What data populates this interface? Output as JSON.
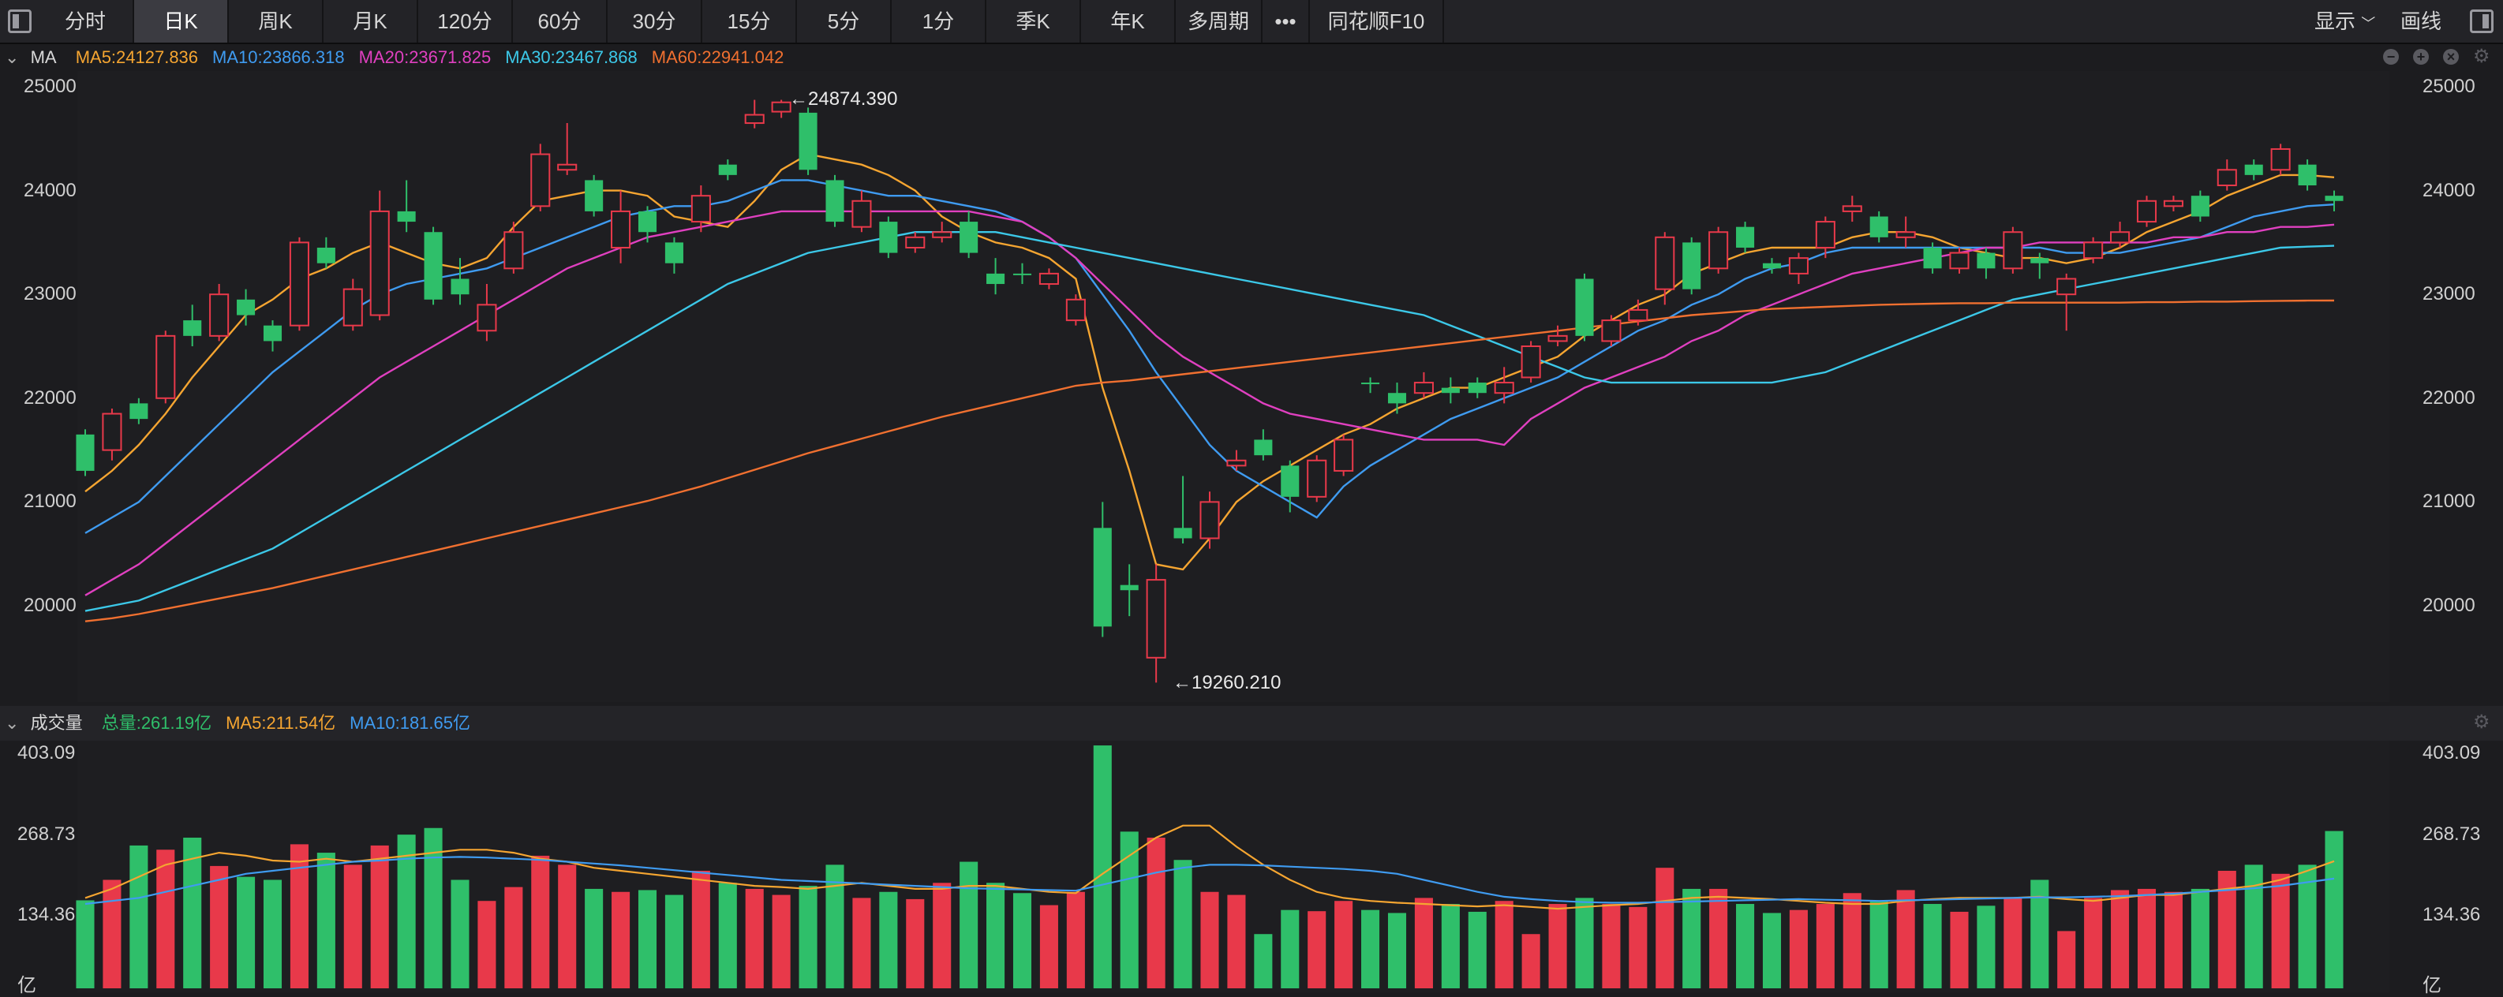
{
  "toolbar": {
    "tabs": [
      "分时",
      "日K",
      "周K",
      "月K",
      "120分",
      "60分",
      "30分",
      "15分",
      "5分",
      "1分",
      "季K",
      "年K",
      "多周期"
    ],
    "more": "•••",
    "f10": "同花顺F10",
    "display": "显示",
    "draw": "画线",
    "active_tab": "日K"
  },
  "ma_legend": {
    "label": "MA",
    "items": [
      {
        "text": "MA5:24127.836",
        "color": "#f5a531"
      },
      {
        "text": "MA10:23866.318",
        "color": "#3f9bf0"
      },
      {
        "text": "MA20:23671.825",
        "color": "#e040c0"
      },
      {
        "text": "MA30:23467.868",
        "color": "#3cc8e8"
      },
      {
        "text": "MA60:22941.042",
        "color": "#f07030"
      }
    ]
  },
  "price_axis": [
    "25000",
    "24000",
    "23000",
    "22000",
    "21000",
    "20000"
  ],
  "annotations": {
    "high": "←24874.390",
    "low": "←19260.210"
  },
  "volume_legend": {
    "label": "成交量",
    "items": [
      {
        "text": "总量:261.19亿",
        "color": "#2fbf6a"
      },
      {
        "text": "MA5:211.54亿",
        "color": "#f5a531"
      },
      {
        "text": "MA10:181.65亿",
        "color": "#3f9bf0"
      }
    ]
  },
  "volume_axis": [
    "403.09",
    "268.73",
    "134.36",
    "亿"
  ],
  "colors": {
    "up": "#e8394a",
    "down": "#2fbf6a"
  },
  "chart_data": {
    "type": "candlestick",
    "ylim": [
      19000,
      25200
    ],
    "volume_ylim": [
      0,
      403.09
    ],
    "candles": [
      [
        21650,
        21300,
        21700,
        21250,
        "d",
        146
      ],
      [
        21500,
        21850,
        21900,
        21400,
        "u",
        180
      ],
      [
        21800,
        21950,
        22000,
        21750,
        "d",
        237
      ],
      [
        22000,
        22600,
        22650,
        21950,
        "u",
        230
      ],
      [
        22750,
        22600,
        22900,
        22500,
        "d",
        250
      ],
      [
        22600,
        23000,
        23100,
        22550,
        "u",
        203
      ],
      [
        22950,
        22800,
        23050,
        22700,
        "d",
        185
      ],
      [
        22700,
        22550,
        22750,
        22450,
        "d",
        180
      ],
      [
        22700,
        23500,
        23550,
        22650,
        "u",
        239
      ],
      [
        23450,
        23300,
        23550,
        23250,
        "d",
        225
      ],
      [
        22700,
        23050,
        23150,
        22650,
        "u",
        205
      ],
      [
        22800,
        23800,
        24000,
        22750,
        "u",
        237
      ],
      [
        23800,
        23700,
        24100,
        23600,
        "d",
        255
      ],
      [
        23600,
        22950,
        23650,
        22900,
        "d",
        266
      ],
      [
        23150,
        23000,
        23350,
        22900,
        "d",
        180
      ],
      [
        22650,
        22900,
        23100,
        22550,
        "u",
        145
      ],
      [
        23250,
        23600,
        23700,
        23200,
        "u",
        168
      ],
      [
        23850,
        24350,
        24450,
        23800,
        "u",
        220
      ],
      [
        24200,
        24250,
        24650,
        24150,
        "u",
        205
      ],
      [
        24100,
        23800,
        24150,
        23750,
        "d",
        165
      ],
      [
        23800,
        23450,
        24000,
        23300,
        "u",
        160
      ],
      [
        23800,
        23600,
        23850,
        23500,
        "d",
        163
      ],
      [
        23500,
        23300,
        23550,
        23200,
        "d",
        155
      ],
      [
        23700,
        23950,
        24050,
        23600,
        "u",
        195
      ],
      [
        24150,
        24250,
        24300,
        24100,
        "d",
        175
      ],
      [
        24650,
        24730,
        24874,
        24600,
        "u",
        165
      ],
      [
        24760,
        24850,
        24874,
        24700,
        "u",
        155
      ],
      [
        24750,
        24200,
        24800,
        24150,
        "d",
        170
      ],
      [
        24100,
        23700,
        24150,
        23650,
        "d",
        205
      ],
      [
        23650,
        23900,
        24000,
        23600,
        "u",
        150
      ],
      [
        23700,
        23400,
        23750,
        23350,
        "d",
        160
      ],
      [
        23450,
        23550,
        23600,
        23400,
        "u",
        148
      ],
      [
        23550,
        23600,
        23700,
        23500,
        "u",
        175
      ],
      [
        23700,
        23400,
        23800,
        23350,
        "d",
        210
      ],
      [
        23200,
        23100,
        23350,
        23000,
        "d",
        175
      ],
      [
        23200,
        23200,
        23300,
        23100,
        "d",
        158
      ],
      [
        23100,
        23200,
        23250,
        23050,
        "u",
        138
      ],
      [
        22750,
        22950,
        23000,
        22700,
        "u",
        160
      ],
      [
        20750,
        19800,
        21000,
        19700,
        "d",
        403
      ],
      [
        20150,
        20200,
        20400,
        19900,
        "d",
        260
      ],
      [
        19500,
        20250,
        20400,
        19260,
        "u",
        250
      ],
      [
        20750,
        20650,
        21250,
        20600,
        "d",
        213
      ],
      [
        20650,
        21000,
        21100,
        20550,
        "u",
        160
      ],
      [
        21350,
        21400,
        21500,
        21300,
        "u",
        155
      ],
      [
        21600,
        21450,
        21700,
        21400,
        "d",
        90
      ],
      [
        21350,
        21050,
        21400,
        20900,
        "d",
        130
      ],
      [
        21050,
        21400,
        21450,
        21000,
        "u",
        128
      ],
      [
        21300,
        21600,
        21650,
        21250,
        "u",
        145
      ],
      [
        22150,
        22150,
        22200,
        22050,
        "d",
        130
      ],
      [
        22050,
        21950,
        22150,
        21850,
        "d",
        125
      ],
      [
        22050,
        22150,
        22250,
        22000,
        "u",
        150
      ],
      [
        22100,
        22050,
        22200,
        21950,
        "d",
        140
      ],
      [
        22150,
        22050,
        22200,
        22000,
        "d",
        127
      ],
      [
        22050,
        22150,
        22300,
        21950,
        "u",
        145
      ],
      [
        22200,
        22500,
        22550,
        22150,
        "u",
        90
      ],
      [
        22550,
        22600,
        22700,
        22500,
        "u",
        140
      ],
      [
        22600,
        23150,
        23200,
        22550,
        "d",
        150
      ],
      [
        22750,
        22550,
        22800,
        22500,
        "u",
        140
      ],
      [
        22750,
        22850,
        22950,
        22700,
        "u",
        135
      ],
      [
        23050,
        23550,
        23600,
        22900,
        "u",
        200
      ],
      [
        23500,
        23050,
        23550,
        23000,
        "d",
        165
      ],
      [
        23250,
        23600,
        23650,
        23200,
        "u",
        165
      ],
      [
        23650,
        23450,
        23700,
        23400,
        "d",
        140
      ],
      [
        23300,
        23250,
        23350,
        23200,
        "d",
        125
      ],
      [
        23200,
        23350,
        23400,
        23100,
        "u",
        130
      ],
      [
        23450,
        23700,
        23750,
        23350,
        "u",
        140
      ],
      [
        23800,
        23850,
        23950,
        23700,
        "u",
        158
      ],
      [
        23750,
        23550,
        23800,
        23500,
        "d",
        145
      ],
      [
        23550,
        23600,
        23750,
        23450,
        "u",
        163
      ],
      [
        23450,
        23250,
        23500,
        23200,
        "d",
        140
      ],
      [
        23400,
        23250,
        23450,
        23200,
        "u",
        127
      ],
      [
        23250,
        23400,
        23450,
        23150,
        "d",
        137
      ],
      [
        23250,
        23600,
        23650,
        23200,
        "u",
        150
      ],
      [
        23350,
        23300,
        23400,
        23150,
        "d",
        180
      ],
      [
        23150,
        23000,
        23200,
        22650,
        "u",
        95
      ],
      [
        23350,
        23500,
        23550,
        23300,
        "u",
        150
      ],
      [
        23500,
        23600,
        23700,
        23450,
        "u",
        163
      ],
      [
        23700,
        23900,
        23950,
        23650,
        "u",
        165
      ],
      [
        23900,
        23850,
        23950,
        23800,
        "u",
        160
      ],
      [
        23750,
        23950,
        24000,
        23700,
        "d",
        165
      ],
      [
        24050,
        24200,
        24300,
        24000,
        "u",
        195
      ],
      [
        24150,
        24250,
        24300,
        24100,
        "d",
        205
      ],
      [
        24200,
        24400,
        24450,
        24150,
        "u",
        190
      ],
      [
        24250,
        24050,
        24300,
        24000,
        "d",
        205
      ],
      [
        23950,
        23900,
        24000,
        23800,
        "d",
        261
      ]
    ],
    "ma": {
      "MA5": [
        21100,
        21300,
        21550,
        21850,
        22200,
        22500,
        22800,
        22950,
        23150,
        23250,
        23400,
        23500,
        23400,
        23300,
        23250,
        23350,
        23650,
        23900,
        23950,
        24000,
        24000,
        23950,
        23750,
        23700,
        23650,
        23900,
        24200,
        24350,
        24300,
        24250,
        24150,
        24000,
        23750,
        23600,
        23500,
        23450,
        23350,
        23150,
        22100,
        21300,
        20400,
        20350,
        20650,
        21000,
        21200,
        21350,
        21500,
        21650,
        21750,
        21900,
        22000,
        22100,
        22100,
        22200,
        22300,
        22400,
        22600,
        22750,
        22900,
        23000,
        23200,
        23300,
        23400,
        23450,
        23450,
        23450,
        23550,
        23600,
        23600,
        23550,
        23450,
        23400,
        23350,
        23350,
        23300,
        23350,
        23450,
        23600,
        23700,
        23800,
        23950,
        24050,
        24150,
        24150,
        24128
      ],
      "MA10": [
        20700,
        20850,
        21000,
        21250,
        21500,
        21750,
        22000,
        22250,
        22450,
        22650,
        22850,
        23000,
        23100,
        23150,
        23200,
        23250,
        23350,
        23450,
        23550,
        23650,
        23750,
        23800,
        23850,
        23850,
        23900,
        24000,
        24100,
        24100,
        24050,
        24000,
        23950,
        23950,
        23900,
        23850,
        23800,
        23700,
        23550,
        23350,
        23000,
        22650,
        22250,
        21900,
        21550,
        21300,
        21150,
        21000,
        20850,
        21150,
        21350,
        21500,
        21650,
        21800,
        21900,
        22000,
        22100,
        22200,
        22350,
        22500,
        22650,
        22750,
        22900,
        23000,
        23150,
        23250,
        23300,
        23400,
        23450,
        23450,
        23450,
        23450,
        23450,
        23450,
        23450,
        23450,
        23400,
        23400,
        23400,
        23450,
        23500,
        23550,
        23650,
        23750,
        23800,
        23850,
        23866
      ],
      "MA20": [
        20100,
        20250,
        20400,
        20600,
        20800,
        21000,
        21200,
        21400,
        21600,
        21800,
        22000,
        22200,
        22350,
        22500,
        22650,
        22800,
        22950,
        23100,
        23250,
        23350,
        23450,
        23550,
        23600,
        23650,
        23700,
        23750,
        23800,
        23800,
        23800,
        23800,
        23800,
        23800,
        23800,
        23800,
        23750,
        23700,
        23550,
        23350,
        23100,
        22850,
        22600,
        22400,
        22250,
        22100,
        21950,
        21850,
        21800,
        21750,
        21700,
        21650,
        21600,
        21600,
        21600,
        21550,
        21800,
        21950,
        22100,
        22200,
        22300,
        22400,
        22550,
        22650,
        22800,
        22900,
        23000,
        23100,
        23200,
        23250,
        23300,
        23350,
        23400,
        23450,
        23450,
        23500,
        23500,
        23500,
        23500,
        23500,
        23550,
        23550,
        23600,
        23600,
        23650,
        23650,
        23672
      ],
      "MA30": [
        19950,
        20000,
        20050,
        20150,
        20250,
        20350,
        20450,
        20550,
        20700,
        20850,
        21000,
        21150,
        21300,
        21450,
        21600,
        21750,
        21900,
        22050,
        22200,
        22350,
        22500,
        22650,
        22800,
        22950,
        23100,
        23200,
        23300,
        23400,
        23450,
        23500,
        23550,
        23600,
        23600,
        23600,
        23600,
        23550,
        23500,
        23450,
        23400,
        23350,
        23300,
        23250,
        23200,
        23150,
        23100,
        23050,
        23000,
        22950,
        22900,
        22850,
        22800,
        22700,
        22600,
        22500,
        22400,
        22300,
        22200,
        22150,
        22150,
        22150,
        22150,
        22150,
        22150,
        22150,
        22200,
        22250,
        22350,
        22450,
        22550,
        22650,
        22750,
        22850,
        22950,
        23000,
        23050,
        23100,
        23150,
        23200,
        23250,
        23300,
        23350,
        23400,
        23450,
        23460,
        23468
      ],
      "MA60": [
        19850,
        19880,
        19920,
        19970,
        20020,
        20070,
        20120,
        20170,
        20230,
        20290,
        20350,
        20410,
        20470,
        20530,
        20590,
        20650,
        20710,
        20770,
        20830,
        20890,
        20950,
        21010,
        21080,
        21150,
        21230,
        21310,
        21390,
        21470,
        21540,
        21610,
        21680,
        21750,
        21820,
        21880,
        21940,
        22000,
        22060,
        22120,
        22150,
        22170,
        22200,
        22230,
        22260,
        22290,
        22320,
        22350,
        22380,
        22410,
        22440,
        22470,
        22500,
        22530,
        22560,
        22590,
        22620,
        22650,
        22680,
        22710,
        22740,
        22770,
        22800,
        22820,
        22840,
        22860,
        22870,
        22880,
        22890,
        22900,
        22905,
        22910,
        22915,
        22915,
        22920,
        22920,
        22920,
        22920,
        22920,
        22925,
        22925,
        22930,
        22930,
        22935,
        22938,
        22940,
        22941
      ]
    },
    "volume_ma": {
      "MA5": [
        150,
        165,
        185,
        205,
        215,
        225,
        220,
        212,
        210,
        215,
        210,
        215,
        220,
        225,
        230,
        230,
        225,
        215,
        210,
        200,
        195,
        190,
        185,
        180,
        175,
        170,
        168,
        165,
        170,
        175,
        170,
        165,
        165,
        170,
        170,
        165,
        160,
        158,
        190,
        220,
        250,
        270,
        270,
        235,
        205,
        180,
        160,
        150,
        145,
        142,
        140,
        138,
        136,
        138,
        135,
        132,
        135,
        138,
        140,
        145,
        150,
        152,
        150,
        148,
        145,
        142,
        140,
        140,
        145,
        148,
        150,
        150,
        150,
        152,
        148,
        145,
        150,
        155,
        155,
        160,
        165,
        170,
        180,
        195,
        211
      ],
      "MA10": [
        140,
        145,
        150,
        160,
        170,
        180,
        190,
        195,
        200,
        205,
        210,
        212,
        215,
        217,
        218,
        217,
        215,
        213,
        210,
        207,
        204,
        200,
        196,
        192,
        188,
        184,
        180,
        178,
        176,
        174,
        172,
        170,
        168,
        166,
        165,
        164,
        163,
        162,
        172,
        182,
        192,
        200,
        205,
        205,
        204,
        202,
        200,
        198,
        195,
        190,
        180,
        170,
        160,
        152,
        148,
        145,
        143,
        142,
        142,
        143,
        144,
        145,
        146,
        147,
        148,
        147,
        146,
        145,
        146,
        147,
        148,
        149,
        150,
        151,
        151,
        152,
        153,
        155,
        157,
        160,
        163,
        166,
        170,
        176,
        182
      ]
    }
  }
}
